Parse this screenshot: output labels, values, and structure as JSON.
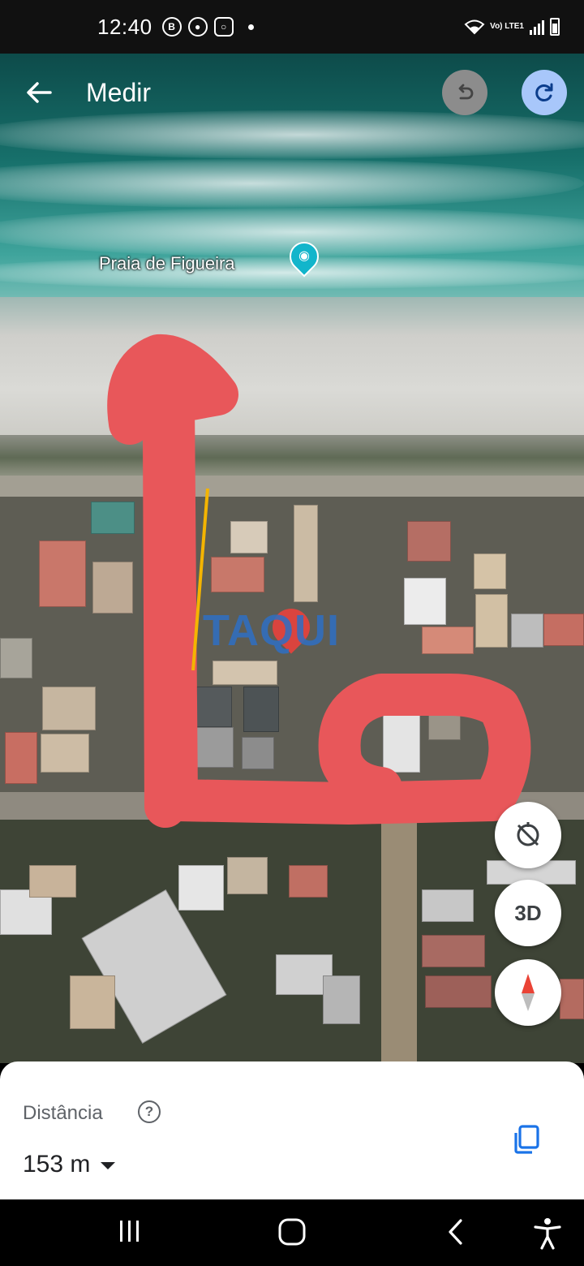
{
  "status_bar": {
    "time": "12:40",
    "icons": [
      "b-icon",
      "chrome-icon",
      "instagram-icon",
      "dot"
    ],
    "network": "Vo) LTE1",
    "right_icons": [
      "wifi-icon",
      "signal-icon",
      "battery-icon"
    ]
  },
  "header": {
    "title": "Medir",
    "back_icon": "arrow-left-icon",
    "undo_icon": "undo-icon",
    "redo_icon": "redo-icon"
  },
  "map": {
    "place_label": "Praia de Figueira",
    "place_icon": "camera-pin-icon",
    "watermark": "TAQUI",
    "measure_line_color": "#f4b400",
    "annotation_color": "#e8575a"
  },
  "controls": {
    "compass_reset_icon": "tilt-icon",
    "view_3d": "3D",
    "north_icon": "compass-icon"
  },
  "sheet": {
    "distance_label": "Distância",
    "help_icon": "question-icon",
    "distance_value": "153 m",
    "unit_dropdown_icon": "caret-down-icon",
    "copy_icon": "copy-icon"
  },
  "navbar": {
    "recents_icon": "recents-icon",
    "home_icon": "home-icon",
    "back_icon": "back-icon",
    "accessibility_icon": "accessibility-icon"
  },
  "colors": {
    "accent": "#1a73e8",
    "redo_bg": "#a8c7fa",
    "undo_bg": "#8c8c8c"
  }
}
